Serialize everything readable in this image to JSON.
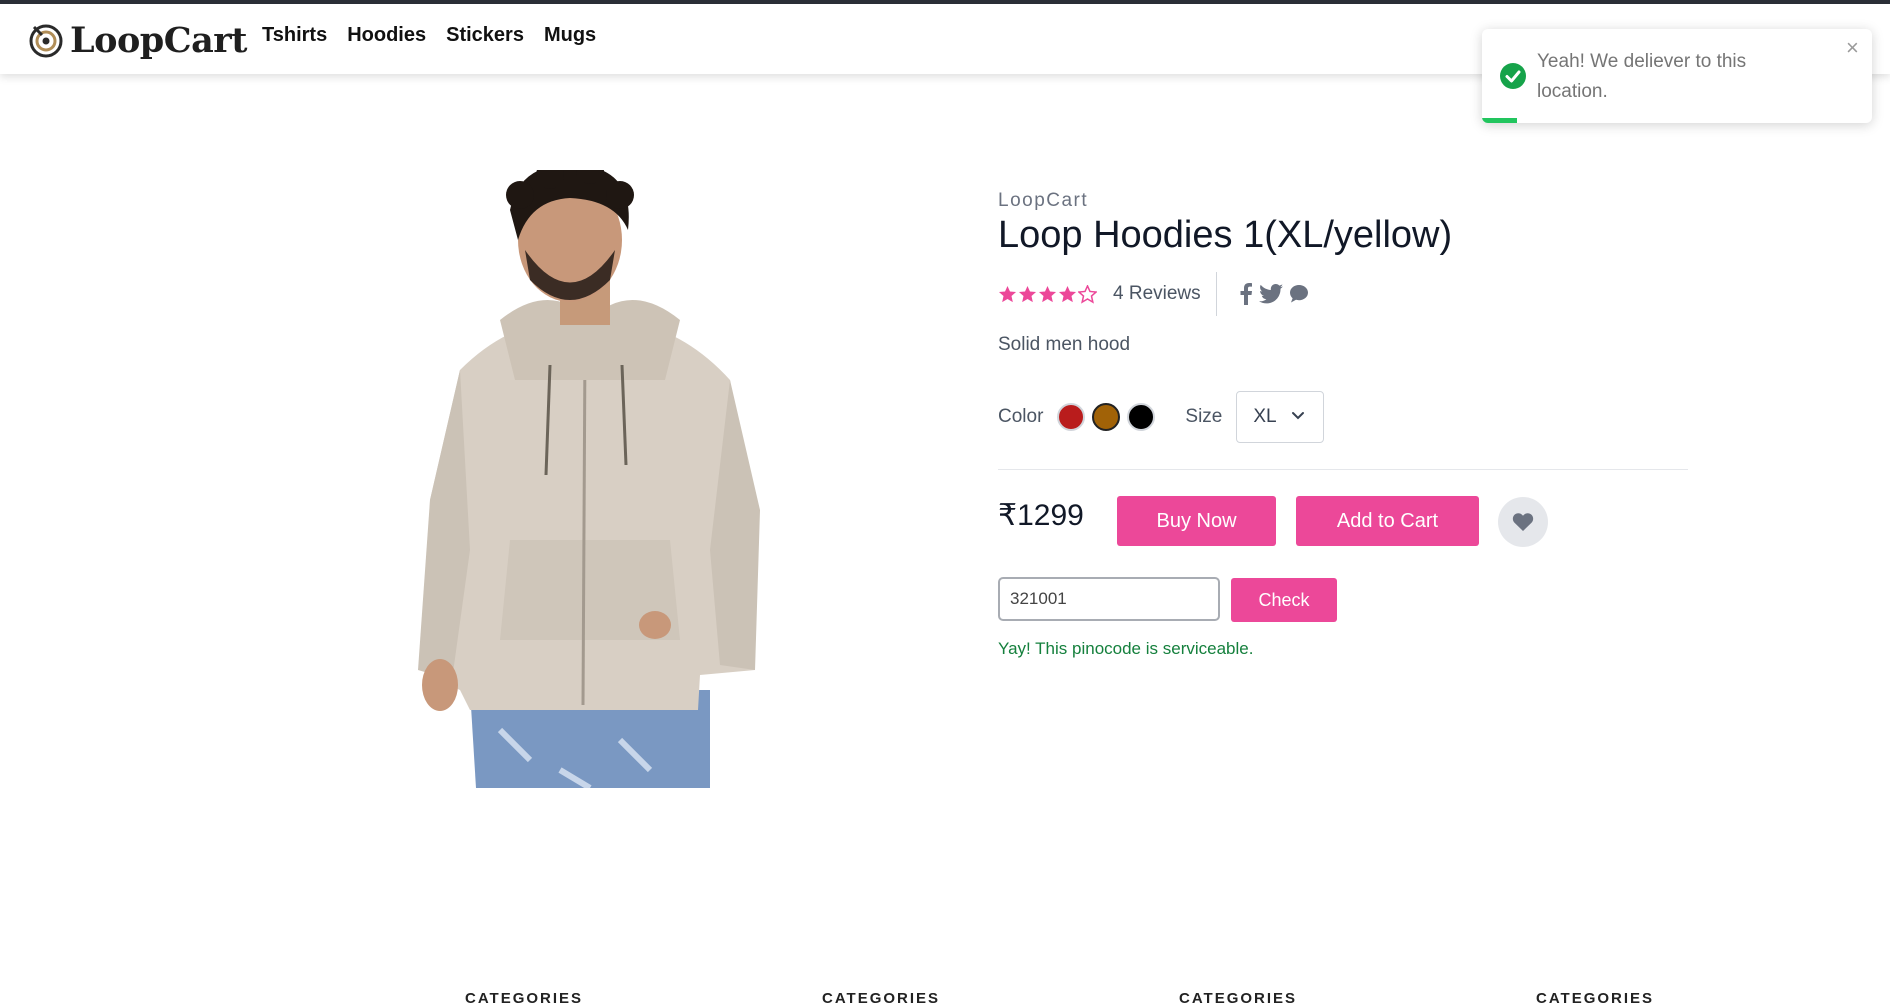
{
  "nav": {
    "brand": "LoopCart",
    "links": [
      "Tshirts",
      "Hoodies",
      "Stickers",
      "Mugs"
    ]
  },
  "toast": {
    "message": "Yeah! We deliever to this location.",
    "close": "×",
    "progress": 0.09,
    "color": "#22c55e"
  },
  "product": {
    "brand": "LoopCart",
    "title": "Loop Hoodies 1(XL/yellow)",
    "rating": 4,
    "rating_max": 5,
    "reviews": "4 Reviews",
    "description": "Solid men hood",
    "color_label": "Color",
    "colors": [
      {
        "name": "red",
        "hex": "#b91c1c"
      },
      {
        "name": "yellow",
        "hex": "#a16207",
        "selected": true
      },
      {
        "name": "black",
        "hex": "#000000"
      }
    ],
    "size_label": "Size",
    "size_value": "XL",
    "price": "₹1299",
    "buy_label": "Buy Now",
    "cart_label": "Add to Cart",
    "share_icons": [
      "facebook-icon",
      "twitter-icon",
      "chat-icon"
    ]
  },
  "pincode": {
    "value": "321001",
    "check_label": "Check",
    "status": "Yay! This pinocode is serviceable."
  },
  "footer": {
    "categories": [
      "CATEGORIES",
      "CATEGORIES",
      "CATEGORIES",
      "CATEGORIES"
    ]
  },
  "colors": {
    "accent": "#ec4899",
    "success": "#15803d"
  }
}
